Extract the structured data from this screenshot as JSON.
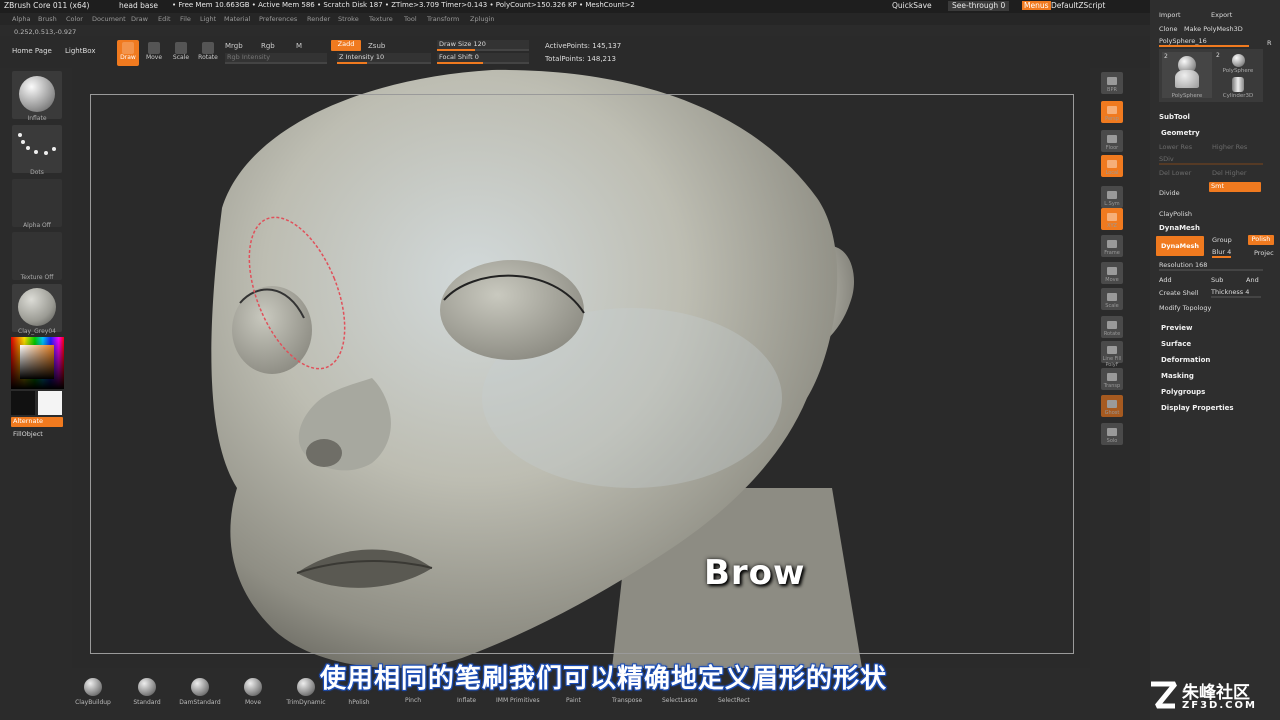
{
  "titlebar": {
    "app": "ZBrush Core 011 (x64)",
    "doc": "head base",
    "stats": "• Free Mem 10.663GB • Active Mem 586 • Scratch Disk 187 • ZTime>3.709 Timer>0.143 • PolyCount>150.326 KP • MeshCount>2",
    "quicksave": "QuickSave",
    "seethrough": "See-through  0",
    "menus": "Menus",
    "script": "DefaultZScript"
  },
  "menubar": [
    "Alpha",
    "Brush",
    "Color",
    "Document",
    "Draw",
    "Edit",
    "File",
    "Light",
    "Material",
    "Preferences",
    "Render",
    "Stroke",
    "Texture",
    "Tool",
    "Transform",
    "Zplugin"
  ],
  "coords": "0.252,0.513,-0.927",
  "toolbar": {
    "home": "Home Page",
    "lightbox": "LightBox",
    "draw": "Draw",
    "move": "Move",
    "scale": "Scale",
    "rotate": "Rotate",
    "mrgb": "Mrgb",
    "rgb": "Rgb",
    "m": "M",
    "rgb_intensity": "Rgb Intensity",
    "zadd": "Zadd",
    "zsub": "Zsub",
    "z_intensity": "Z Intensity 10",
    "draw_size": "Draw Size 120",
    "focal_shift": "Focal Shift 0",
    "active_points": "ActivePoints: 145,137",
    "total_points": "TotalPoints: 148,213"
  },
  "leftshelf": {
    "brush": "Inflate",
    "stroke": "Dots",
    "alpha": "Alpha Off",
    "texture": "Texture Off",
    "material": "Clay_Grey04",
    "alternate": "Alternate",
    "fillobject": "FillObject"
  },
  "rightstrip": [
    "BPR",
    "Persp",
    "Floor",
    "Local",
    "L.Sym",
    "XYZ",
    "Frame",
    "Move",
    "Scale",
    "Rotate",
    "Line Fill PolyF",
    "Transp",
    "Ghost",
    "Solo"
  ],
  "rightpanel": {
    "import": "Import",
    "export": "Export",
    "clone": "Clone",
    "make_polymesh": "Make PolyMesh3D",
    "current_tool": "PolySphere_16",
    "r": "R",
    "thumb1": "PolySphere",
    "thumb2": "PolySphere",
    "thumb3": "Cylinder3D",
    "thumb_num1": "2",
    "thumb_num2": "2",
    "subtool": "SubTool",
    "geometry": "Geometry",
    "lower_res": "Lower Res",
    "higher_res": "Higher Res",
    "sdiv": "SDiv",
    "del_lower": "Del Lower",
    "del_higher": "Del Higher",
    "divide": "Divide",
    "smt": "Smt",
    "claypolish": "ClayPolish",
    "dynamesh_hdr": "DynaMesh",
    "dynamesh_btn": "DynaMesh",
    "group": "Group",
    "polish": "Polish",
    "blur": "Blur 4",
    "project": "Projec",
    "resolution": "Resolution 168",
    "add": "Add",
    "sub": "Sub",
    "and": "And",
    "create_shell": "Create Shell",
    "thickness": "Thickness 4",
    "modify_topology": "Modify Topology",
    "sections": [
      "Preview",
      "Surface",
      "Deformation",
      "Masking",
      "Polygroups",
      "Display Properties"
    ]
  },
  "bottomshelf": {
    "brushes": [
      "ClayBuildup",
      "Standard",
      "DamStandard",
      "Move",
      "TrimDynamic",
      "hPolish"
    ],
    "items": [
      "Pinch",
      "Inflate",
      "IMM Primitives",
      "Paint",
      "Transpose",
      "SelectLasso",
      "SelectRect"
    ]
  },
  "overlay": {
    "brow": "Brow",
    "subtitle": "使用相同的笔刷我们可以精确地定义眉形的形状",
    "watermark_big": "朱峰社区",
    "watermark_small": "ZF3D.COM"
  },
  "colors": {
    "accent": "#f07a1f",
    "background": "#2b2b2b",
    "clay": "#c4c3b6"
  }
}
